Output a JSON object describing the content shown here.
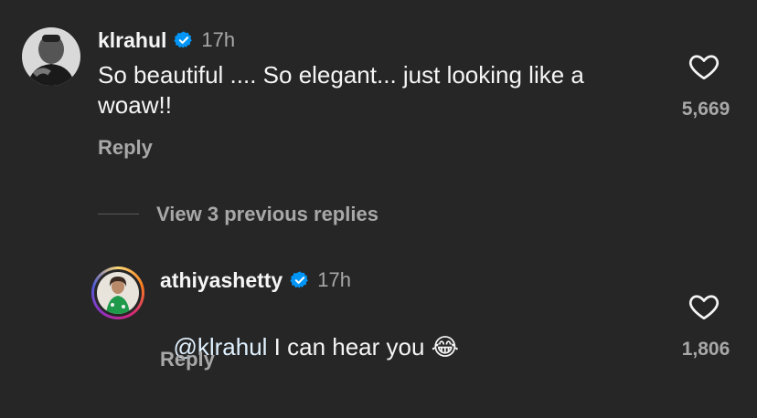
{
  "comment1": {
    "username": "klrahul",
    "verified": true,
    "time": "17h",
    "text": "So beautiful .... So elegant... just looking like a woaw!!",
    "reply_label": "Reply",
    "like_count": "5,669",
    "icons": {
      "like": "heart-icon",
      "verified": "verified-badge-icon"
    }
  },
  "view_previous_replies": "View 3 previous replies",
  "comment2": {
    "username": "athiyashetty",
    "verified": true,
    "time": "17h",
    "mention": "@klrahul",
    "text": " I can hear you ",
    "emoji": "😂",
    "reply_label": "Reply",
    "like_count": "1,806",
    "icons": {
      "like": "heart-icon",
      "verified": "verified-badge-icon"
    }
  },
  "colors": {
    "background": "#262626",
    "primary_text": "#f5f5f5",
    "secondary_text": "#a8a8a8",
    "verified_blue": "#0095f6",
    "mention": "#e0f1ff"
  }
}
